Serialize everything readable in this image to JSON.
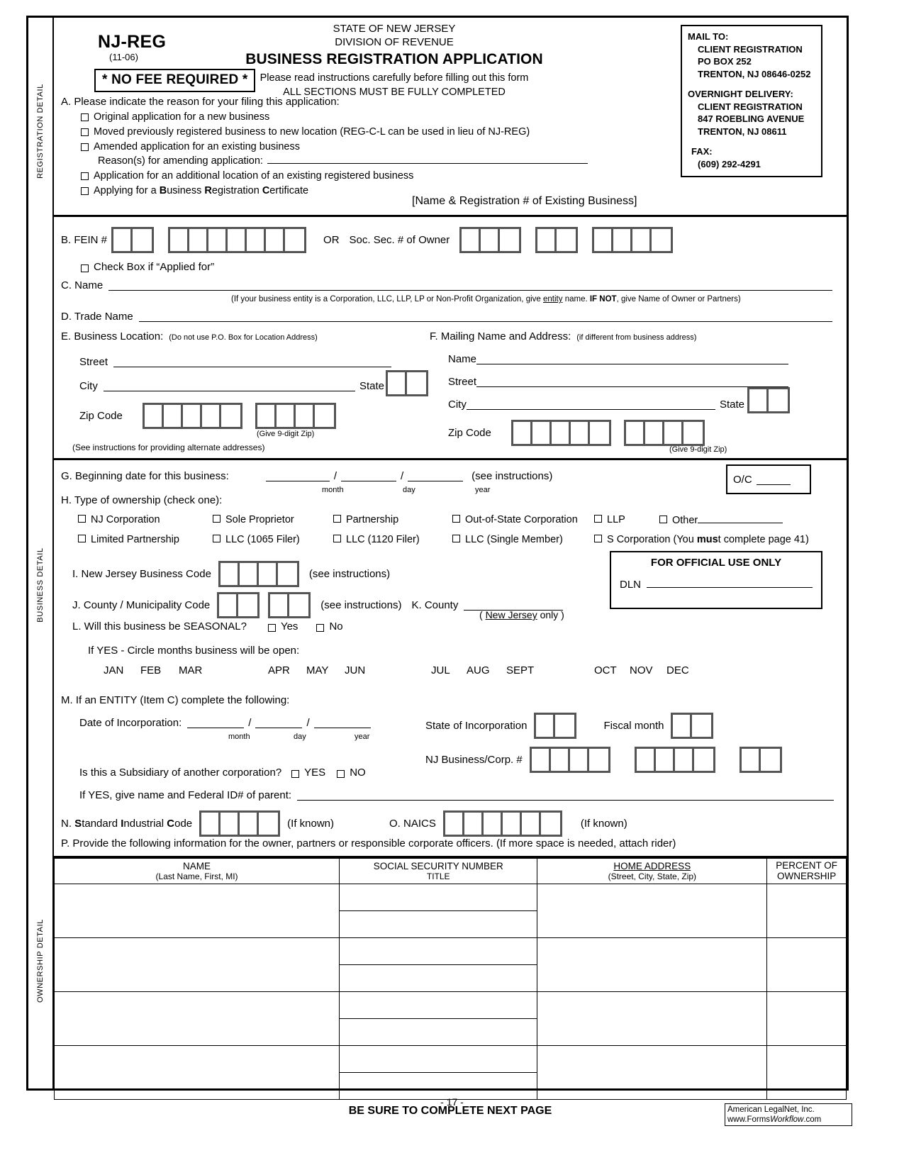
{
  "rails": {
    "registration": "REGISTRATION DETAIL",
    "business": "BUSINESS DETAIL",
    "ownership": "OWNERSHIP DETAIL"
  },
  "header": {
    "form_code": "NJ-REG",
    "revision": "(11-06)",
    "no_fee": "* NO FEE REQUIRED *",
    "state_line": "STATE OF NEW JERSEY",
    "division_line": "DIVISION OF REVENUE",
    "title": "BUSINESS REGISTRATION APPLICATION",
    "instruction_1": "Please read instructions carefully before filling out this form",
    "instruction_2": "ALL SECTIONS MUST BE FULLY COMPLETED"
  },
  "mail_box": {
    "mail_to_label": "MAIL TO:",
    "mail_to_1": "CLIENT REGISTRATION",
    "mail_to_2": "PO BOX 252",
    "mail_to_3": "TRENTON, NJ 08646-0252",
    "overnight_label": "OVERNIGHT DELIVERY:",
    "overnight_1": "CLIENT REGISTRATION",
    "overnight_2": "847 ROEBLING AVENUE",
    "overnight_3": "TRENTON, NJ 08611",
    "fax_label": "FAX:",
    "fax_number": "(609) 292-4291"
  },
  "section_a": {
    "prompt": "A.  Please indicate the reason for your filing this application:",
    "options": [
      "Original application for a new business",
      "Moved previously registered business to new location (REG-C-L can be used in lieu of NJ-REG)",
      "Amended application for an existing business"
    ],
    "reason_label": "Reason(s) for amending application:",
    "options_2": [
      "Application for an additional location of an existing registered business"
    ],
    "brc_prefix": "Applying for a ",
    "brc_b": "B",
    "brc_usiness": "usiness ",
    "brc_r": "R",
    "brc_egistration": "egistration ",
    "brc_c": "C",
    "brc_ertificate": "ertificate",
    "existing_business_note": "[Name & Registration # of Existing Business]"
  },
  "section_b": {
    "label": "B.  FEIN #",
    "fein_group_1_cells": 2,
    "fein_group_2_cells": 7,
    "or_label": "OR",
    "ssn_label": "Soc. Sec. # of Owner",
    "ssn_group_1_cells": 3,
    "ssn_group_2_cells": 2,
    "ssn_group_3_cells": 4,
    "applied_for": "Check Box if “Applied for”"
  },
  "section_c": {
    "label": "C.  Name",
    "note": "(If your business entity is a Corporation, LLC, LLP, LP or Non-Profit Organization, give ",
    "note_u": "entity",
    "note_2": " name.  ",
    "note_b": "IF NOT",
    "note_3": ", give Name of Owner or Partners)"
  },
  "section_d": {
    "label": "D.  Trade Name"
  },
  "section_e": {
    "label": "E.  Business Location:",
    "note": "(Do not use P.O. Box for Location Address)",
    "street": "Street",
    "city": "City",
    "state": "State",
    "zip": "Zip Code",
    "zip_group_1_cells": 5,
    "zip_group_2_cells": 4,
    "state_cells": 2,
    "zip_note": "(Give 9-digit Zip)",
    "alt_note": "(See instructions for providing alternate addresses)"
  },
  "section_f": {
    "label": "F.  Mailing Name and Address:",
    "note": "(if different from business address)",
    "name": "Name",
    "street": "Street",
    "city": "City",
    "state": "State",
    "zip": "Zip Code",
    "zip_group_1_cells": 5,
    "zip_group_2_cells": 4,
    "state_cells": 2,
    "zip_note": "(Give 9-digit Zip)"
  },
  "section_g": {
    "label": "G.  Beginning date for this business:",
    "month": "month",
    "day": "day",
    "year": "year",
    "see_instructions": "(see instructions)",
    "oc_label": "O/C"
  },
  "section_h": {
    "label": "H.  Type of ownership (check one):",
    "row1": [
      "NJ Corporation",
      "Sole Proprietor",
      "Partnership",
      "Out-of-State Corporation",
      "LLP",
      "Other"
    ],
    "row2_a": "Limited Partnership",
    "row2_b": "LLC (1065 Filer)",
    "row2_c": "LLC (1120 Filer)",
    "row2_d": "LLC (Single Member)",
    "row2_e_pre": "S Corporation (You ",
    "row2_e_b": "mus",
    "row2_e_post": "t complete page 41)"
  },
  "section_i": {
    "label": "I.  New Jersey Business Code",
    "cells": 4,
    "see_instructions": "(see instructions)"
  },
  "section_j": {
    "label": "J.  County / Municipality Code",
    "group_1_cells": 2,
    "group_2_cells": 2,
    "see_instructions": "(see instructions)"
  },
  "section_k": {
    "label": "K.  County",
    "note_pre": "( ",
    "note_u": "New Jersey",
    "note_post": " only )"
  },
  "official_box": {
    "title": "FOR OFFICIAL USE ONLY",
    "dln_label": "DLN"
  },
  "section_l": {
    "label": "L.  Will this business be SEASONAL?",
    "yes": "Yes",
    "no": "No",
    "if_yes": "If YES - Circle months business will be open:",
    "months": [
      "JAN",
      "FEB",
      "MAR",
      "APR",
      "MAY",
      "JUN",
      "JUL",
      "AUG",
      "SEPT",
      "OCT",
      "NOV",
      "DEC"
    ]
  },
  "section_m": {
    "label": "M.  If an ENTITY (Item C) complete the following:",
    "date_of_incorporation": "Date of Incorporation:",
    "month": "month",
    "day": "day",
    "year": "year",
    "state_of_incorporation": "State of Incorporation",
    "state_cells": 2,
    "fiscal_month": "Fiscal month",
    "fiscal_cells": 2,
    "nj_corp_label": "NJ Business/Corp. #",
    "corp_group_1_cells": 4,
    "corp_group_2_cells": 4,
    "corp_group_3_cells": 2,
    "subsidiary_q": "Is this a Subsidiary of another corporation?",
    "yes": "YES",
    "no": "NO",
    "parent_label": "If YES, give name and Federal ID# of parent:"
  },
  "section_n": {
    "label_pre": "N.  ",
    "s": "S",
    "tandard": "tandard ",
    "i": "I",
    "ndustrial": "ndustrial ",
    "c": "C",
    "ode": "ode",
    "cells": 4,
    "if_known": "(If known)"
  },
  "section_o": {
    "label": "O. NAICS",
    "cells": 6,
    "if_known": "(If known)"
  },
  "section_p": {
    "label": "P.  Provide the following information for the owner, partners or responsible corporate officers.  (If more space is needed, attach rider)"
  },
  "ownership_table": {
    "columns": [
      {
        "header": "NAME",
        "sub": "(Last Name, First, MI)"
      },
      {
        "header": "SOCIAL SECURITY NUMBER",
        "sub": "TITLE"
      },
      {
        "header": "HOME ADDRESS",
        "sub": "(Street, City, State, Zip)"
      },
      {
        "header": "PERCENT OF",
        "sub": "OWNERSHIP"
      }
    ],
    "row_count": 4
  },
  "footer": {
    "next_page": "BE SURE TO COMPLETE NEXT PAGE",
    "page_number": "- 17 -",
    "legal_1": "American LegalNet, Inc.",
    "legal_2_pre": "www.Forms",
    "legal_2_i": "Workflow",
    "legal_2_post": ".com"
  }
}
